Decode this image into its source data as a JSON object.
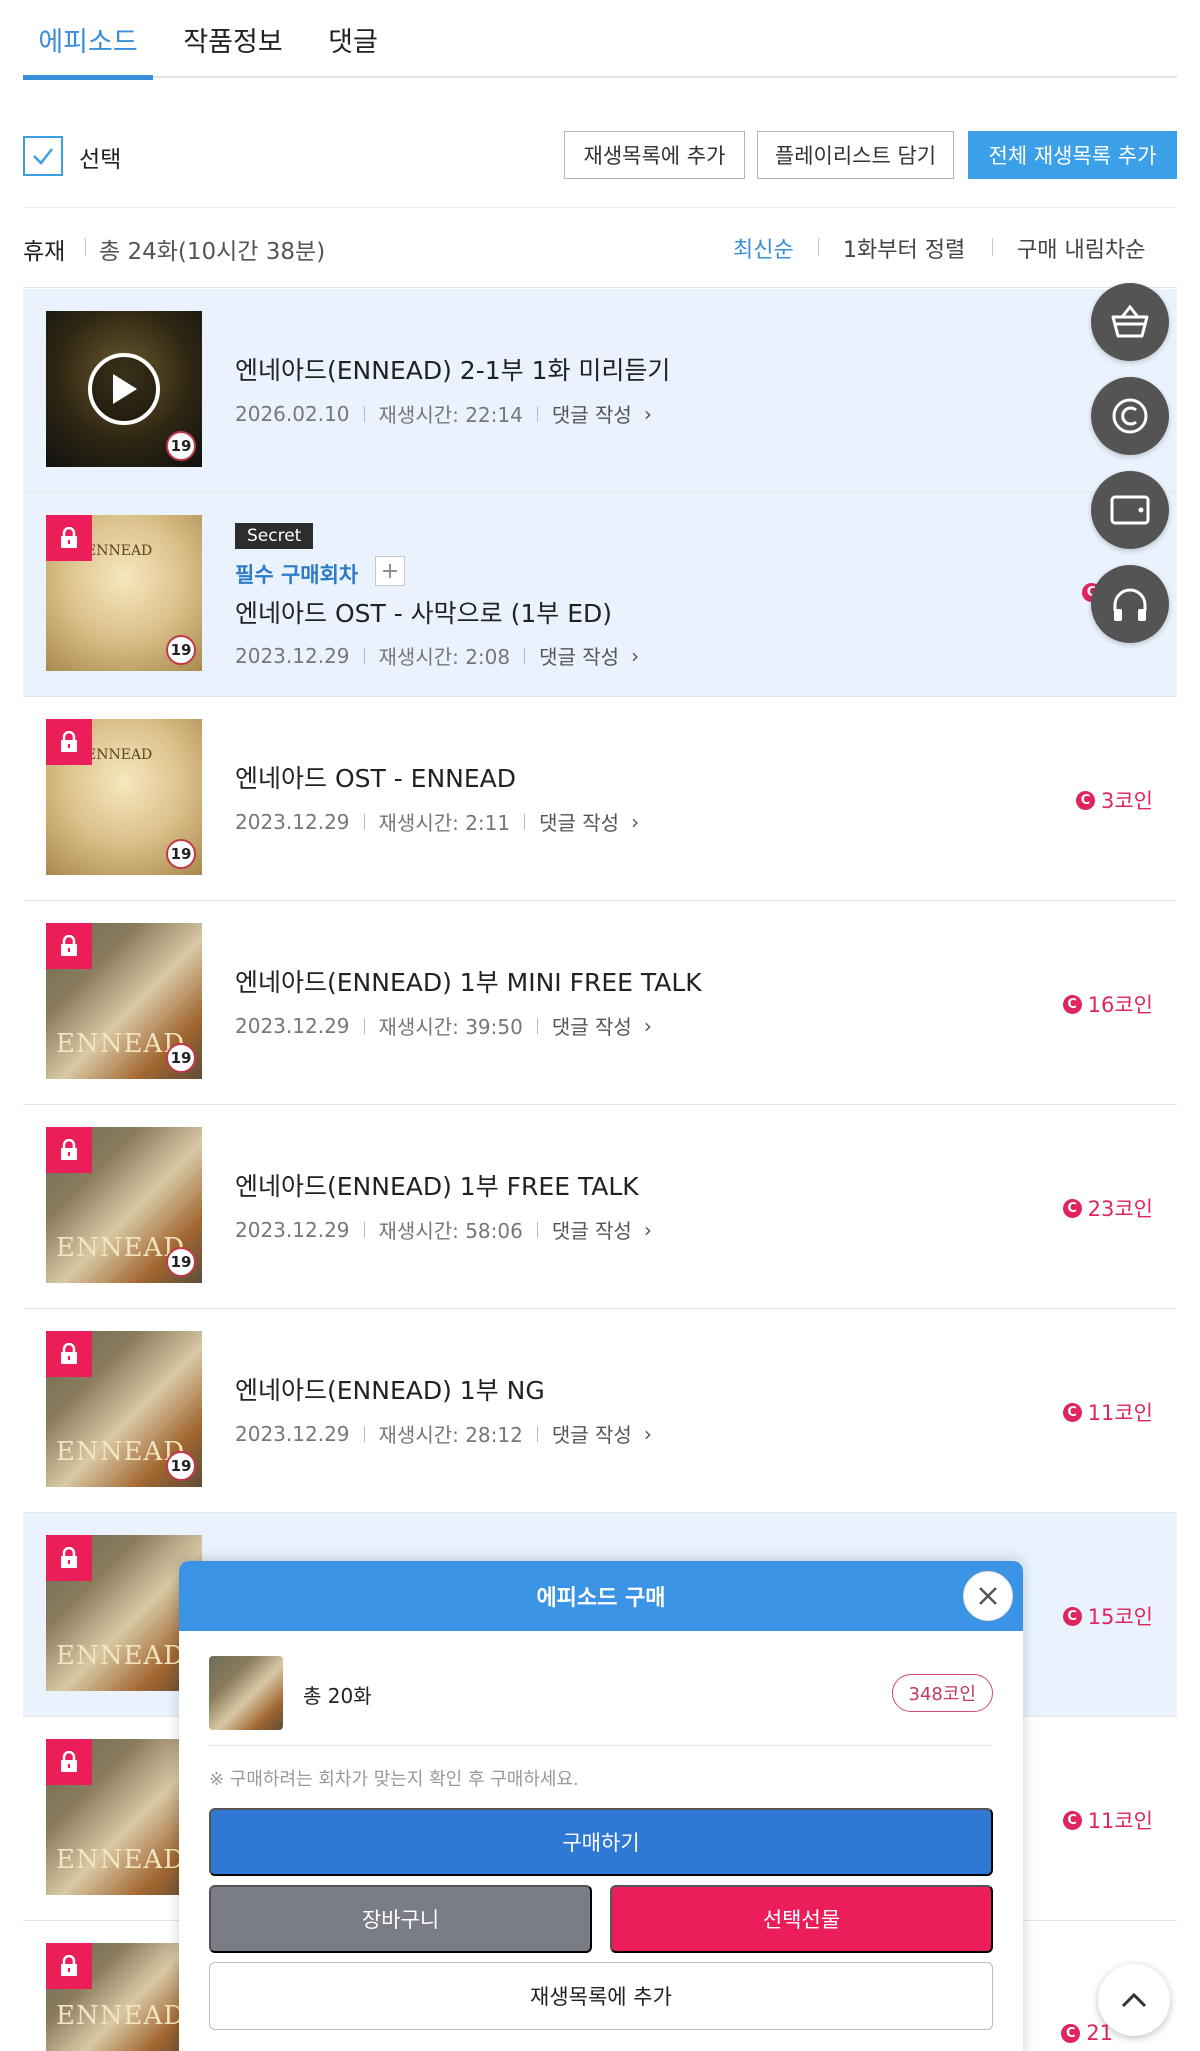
{
  "tabs": [
    "에피소드",
    "작품정보",
    "댓글"
  ],
  "actions": {
    "select_label": "선택",
    "add_to_playback": "재생목록에 추가",
    "add_to_playlist": "플레이리스트 담기",
    "add_all_playback": "전체 재생목록 추가"
  },
  "status_bar": {
    "status": "휴재",
    "total": "총 24화(10시간 38분)",
    "sort_options": [
      "최신순",
      "1화부터 정렬",
      "구매 내림차순"
    ],
    "active_sort": "최신순"
  },
  "episodes": [
    {
      "title": "엔네아드(ENNEAD) 2-1부 1화 미리듣기",
      "date": "2026.02.10",
      "duration": "재생시간: 22:14",
      "comment": "댓글 작성",
      "price": "",
      "locked": false,
      "thumb": "dark"
    },
    {
      "title": "엔네아드 OST - 사막으로 (1부 ED)",
      "date": "2023.12.29",
      "duration": "재생시간: 2:08",
      "comment": "댓글 작성",
      "price": "",
      "locked": true,
      "thumb": "gold",
      "secret": "Secret",
      "must_buy": "필수 구매회차"
    },
    {
      "title": "엔네아드 OST - ENNEAD",
      "date": "2023.12.29",
      "duration": "재생시간: 2:11",
      "comment": "댓글 작성",
      "price": "3코인",
      "locked": true,
      "thumb": "gold"
    },
    {
      "title": "엔네아드(ENNEAD) 1부 MINI FREE TALK",
      "date": "2023.12.29",
      "duration": "재생시간: 39:50",
      "comment": "댓글 작성",
      "price": "16코인",
      "locked": true,
      "thumb": "art"
    },
    {
      "title": "엔네아드(ENNEAD) 1부 FREE TALK",
      "date": "2023.12.29",
      "duration": "재생시간: 58:06",
      "comment": "댓글 작성",
      "price": "23코인",
      "locked": true,
      "thumb": "art"
    },
    {
      "title": "엔네아드(ENNEAD) 1부 NG",
      "date": "2023.12.29",
      "duration": "재생시간: 28:12",
      "comment": "댓글 작성",
      "price": "11코인",
      "locked": true,
      "thumb": "art"
    },
    {
      "price": "15코인",
      "locked": true,
      "thumb": "art"
    },
    {
      "price": "11코인",
      "locked": true,
      "thumb": "art"
    },
    {
      "price": "21",
      "locked": true,
      "thumb": "art"
    }
  ],
  "thumb_texts": {
    "art": "ENNEAD",
    "gold": "ENNEAD",
    "age": "19"
  },
  "coin_symbol": "C",
  "floating_buttons": [
    "basket-icon",
    "copyright-icon",
    "tablet-icon",
    "headphones-icon"
  ],
  "modal": {
    "title": "에피소드 구매",
    "count": "총 20화",
    "coins": "348코인",
    "note": "※ 구매하려는 회차가 맞는지 확인 후 구매하세요.",
    "buy": "구매하기",
    "cart": "장바구니",
    "gift": "선택선물",
    "add": "재생목록에 추가"
  },
  "colors": {
    "accent": "#3b8fd9",
    "coin": "#e0245e",
    "lock": "#ec1e5a",
    "buy": "#2f79d5"
  }
}
